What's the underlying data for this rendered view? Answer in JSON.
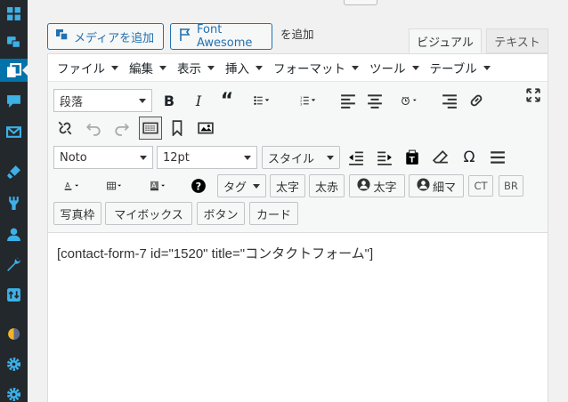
{
  "sidebar": {
    "icons": [
      "dashboard-icon",
      "media-icon",
      "pages-icon",
      "comments-icon",
      "mail-icon",
      "appearance-icon",
      "plugins-icon",
      "users-icon",
      "tools-icon",
      "import-icon",
      "plugin-logo-icon",
      "settings-icon",
      "settings-icon"
    ],
    "active_index": 2,
    "accent": "#0073aa"
  },
  "media_buttons": {
    "add_media": "メディアを追加",
    "font_awesome": "Font Awesome",
    "suffix": "を追加"
  },
  "tabs": {
    "visual": "ビジュアル",
    "text": "テキスト"
  },
  "menubar": [
    "ファイル",
    "編集",
    "表示",
    "挿入",
    "フォーマット",
    "ツール",
    "テーブル"
  ],
  "toolbar": {
    "format_select": "段落",
    "font_select": "Noto",
    "size_select": "12pt",
    "style_select": "スタイル",
    "tag_select": "タグ",
    "buttons": {
      "bold_text": "太字",
      "red_bold": "太赤",
      "user_bold": "太字",
      "user_fine": "細マ",
      "ct": "CT",
      "br": "BR",
      "photo_frame": "写真枠",
      "my_box": "マイボックス",
      "button": "ボタン",
      "card": "カード"
    }
  },
  "content": {
    "text": "[contact-form-7 id=\"1520\" title=\"コンタクトフォーム\"]"
  }
}
